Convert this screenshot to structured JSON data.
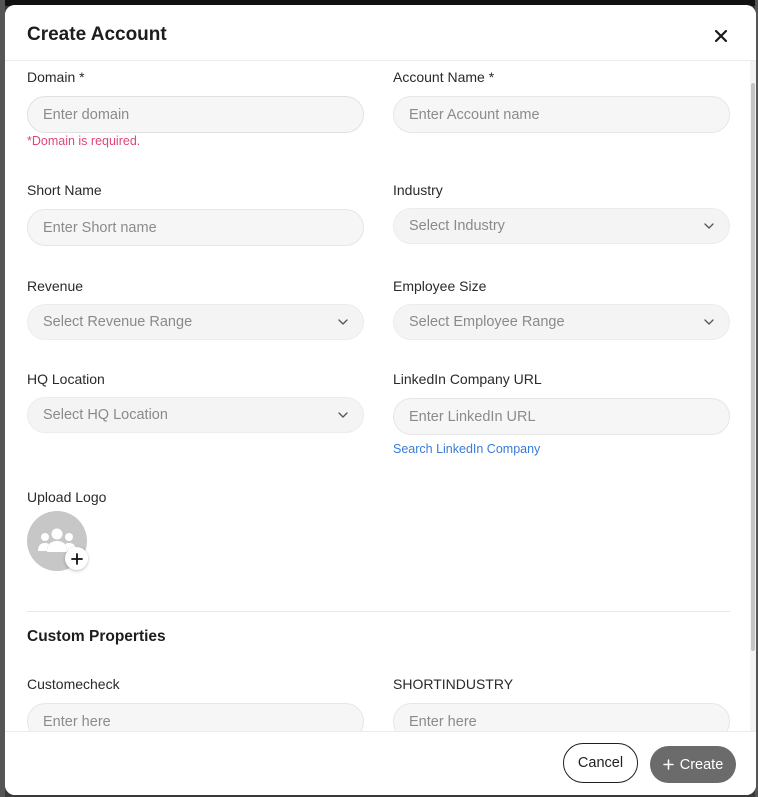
{
  "modal": {
    "title": "Create Account",
    "close_icon": "close-icon"
  },
  "fields": {
    "domain": {
      "label": "Domain *",
      "placeholder": "Enter domain",
      "error": "*Domain is required."
    },
    "account_name": {
      "label": "Account Name *",
      "placeholder": "Enter Account name"
    },
    "short_name": {
      "label": "Short Name",
      "placeholder": "Enter Short name"
    },
    "industry": {
      "label": "Industry",
      "placeholder": "Select Industry"
    },
    "revenue": {
      "label": "Revenue",
      "placeholder": "Select Revenue Range"
    },
    "employee_size": {
      "label": "Employee Size",
      "placeholder": "Select Employee Range"
    },
    "hq_location": {
      "label": "HQ Location",
      "placeholder": "Select HQ Location"
    },
    "linkedin_url": {
      "label": "LinkedIn Company URL",
      "placeholder": "Enter LinkedIn URL",
      "link": "Search LinkedIn Company"
    },
    "upload_logo": {
      "label": "Upload Logo"
    }
  },
  "custom_properties": {
    "title": "Custom Properties",
    "items": [
      {
        "label": "Customecheck",
        "placeholder": "Enter here"
      },
      {
        "label": "SHORTINDUSTRY",
        "placeholder": "Enter here"
      }
    ]
  },
  "footer": {
    "cancel_label": "Cancel",
    "create_label": "Create",
    "create_icon": "plus-icon"
  },
  "colors": {
    "error": "#e0457b",
    "link": "#3b7bd6",
    "primary_button": "#6b6b6b"
  }
}
